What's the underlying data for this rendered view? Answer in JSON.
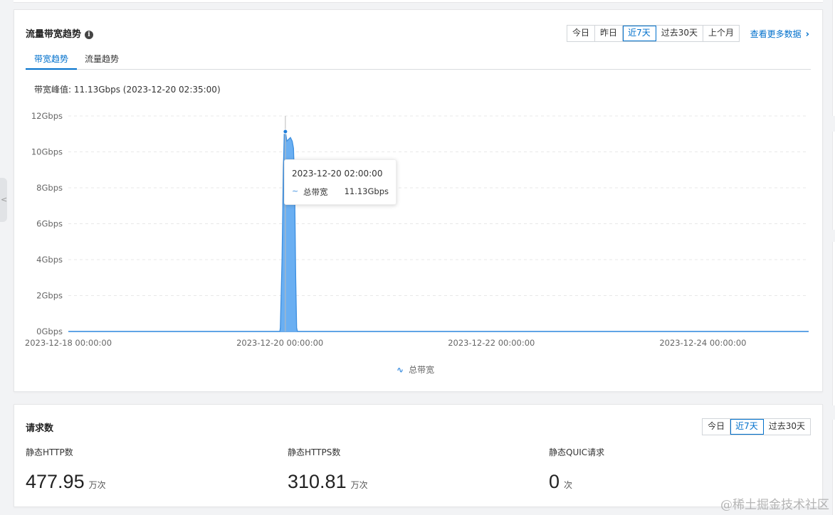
{
  "traffic": {
    "title": "流量带宽趋势",
    "range_buttons": [
      "今日",
      "昨日",
      "近7天",
      "过去30天",
      "上个月"
    ],
    "active_range": "近7天",
    "more_link": "查看更多数据",
    "tabs": [
      "带宽趋势",
      "流量趋势"
    ],
    "active_tab": "带宽趋势",
    "peak_text": "带宽峰值: 11.13Gbps (2023-12-20 02:35:00)",
    "tooltip": {
      "time": "2023-12-20 02:00:00",
      "series": "总带宽",
      "value": "11.13Gbps"
    },
    "legend": "总带宽",
    "accent_color": "#3d8fe0",
    "fill_color": "#6aaff2"
  },
  "chart_data": {
    "type": "area",
    "y_ticks": [
      "12Gbps",
      "10Gbps",
      "8Gbps",
      "6Gbps",
      "4Gbps",
      "2Gbps",
      "0Gbps"
    ],
    "x_ticks": [
      "2023-12-18 00:00:00",
      "2023-12-20 00:00:00",
      "2023-12-22 00:00:00",
      "2023-12-24 00:00:00"
    ],
    "ylim": [
      0,
      12
    ],
    "xlim_hours": [
      0,
      168
    ],
    "series": [
      {
        "name": "总带宽",
        "points": [
          [
            0,
            0
          ],
          [
            48.0,
            0
          ],
          [
            48.1,
            0.2
          ],
          [
            48.5,
            4.0
          ],
          [
            48.8,
            9.0
          ],
          [
            49.0,
            11.0
          ],
          [
            49.25,
            11.13
          ],
          [
            49.6,
            10.6
          ],
          [
            50.0,
            10.7
          ],
          [
            50.4,
            10.8
          ],
          [
            50.8,
            10.6
          ],
          [
            51.1,
            10.2
          ],
          [
            51.35,
            8.0
          ],
          [
            51.6,
            3.0
          ],
          [
            51.8,
            0.2
          ],
          [
            52.0,
            0
          ],
          [
            168,
            0
          ]
        ]
      }
    ],
    "grid": true,
    "legend_position": "bottom"
  },
  "requests": {
    "title": "请求数",
    "range_buttons": [
      "今日",
      "近7天",
      "过去30天"
    ],
    "active_range": "近7天",
    "metrics": [
      {
        "label": "静态HTTP数",
        "value": "477.95",
        "unit": "万次"
      },
      {
        "label": "静态HTTPS数",
        "value": "310.81",
        "unit": "万次"
      },
      {
        "label": "静态QUIC请求",
        "value": "0",
        "unit": "次"
      }
    ]
  },
  "watermark": "@稀土掘金技术社区"
}
